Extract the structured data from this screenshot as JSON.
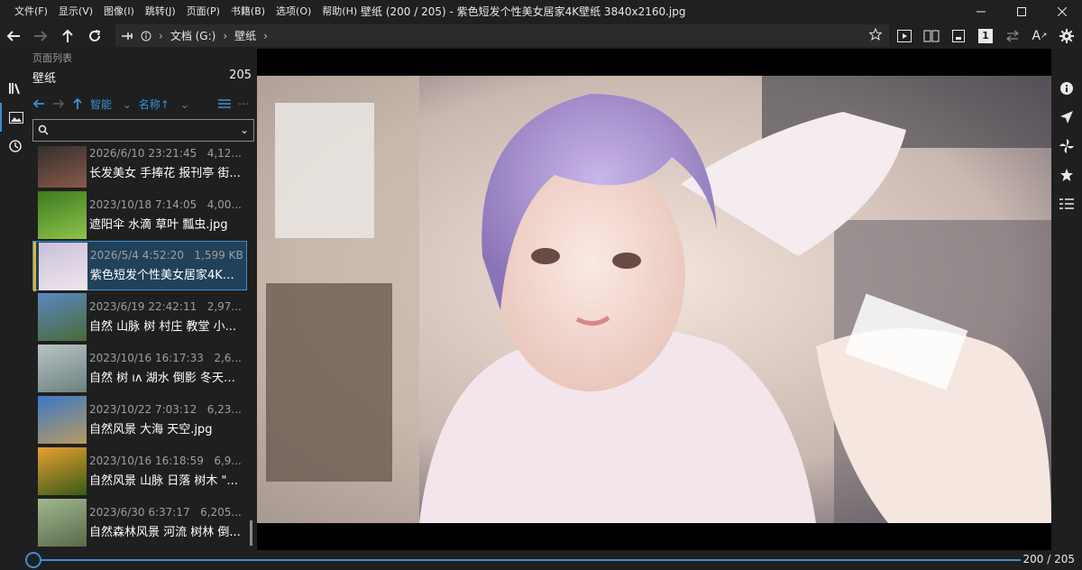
{
  "menu": [
    "文件(F)",
    "显示(V)",
    "图像(I)",
    "跳转(J)",
    "页面(P)",
    "书籍(B)",
    "选项(O)",
    "帮助(H)"
  ],
  "window": {
    "title": "壁纸 (200 / 205) - 紫色短发个性美女居家4K壁纸 3840x2160.jpg"
  },
  "address": {
    "drive": "文档 (G:)",
    "folder": "壁纸"
  },
  "toolbar": {
    "page_badge": "1",
    "text_size_label": "A"
  },
  "panel": {
    "title": "页面列表",
    "folder": "壁纸",
    "count": "205",
    "nav_mode": "智能",
    "sort_label": "名称↑",
    "search_placeholder": ""
  },
  "items": [
    {
      "date": "2026/6/10 23:21:45",
      "size": "4,12...",
      "name": "长发美女 手捧花 报刊亭 街...",
      "thumb": [
        "#2a2a2a",
        "#8a5a4a"
      ]
    },
    {
      "date": "2023/10/18 7:14:05",
      "size": "4,00...",
      "name": "遮阳伞 水滴 草叶 瓢虫.jpg",
      "thumb": [
        "#3d7a1f",
        "#8fc34a"
      ]
    },
    {
      "date": "2026/5/4 4:52:20",
      "size": "1,599 KB",
      "name": "紫色短发个性美女居家4K壁...",
      "thumb": [
        "#c9c0d8",
        "#f0e6ee"
      ]
    },
    {
      "date": "2023/6/19 22:42:11",
      "size": "2,97...",
      "name": "自然 山脉 树 村庄 教堂 小...",
      "thumb": [
        "#5a88c0",
        "#4a6a3a"
      ]
    },
    {
      "date": "2023/10/16 16:17:33",
      "size": "2,6...",
      "name": "自然 树 ıʌ 湖水 倒影 冬天风...",
      "thumb": [
        "#b8c4c4",
        "#6d8080"
      ]
    },
    {
      "date": "2023/10/22 7:03:12",
      "size": "6,23...",
      "name": "自然风景 大海 天空.jpg",
      "thumb": [
        "#3c78c8",
        "#b89a60"
      ]
    },
    {
      "date": "2023/10/16 16:18:59",
      "size": "6,9...",
      "name": "自然风景 山脉 日落 树木 \"...",
      "thumb": [
        "#e8a030",
        "#3a5a1a"
      ]
    },
    {
      "date": "2023/6/30 6:37:17",
      "size": "6,205...",
      "name": "自然森林风景 河流 树林 倒...",
      "thumb": [
        "#9fb890",
        "#5a6a4a"
      ]
    }
  ],
  "status": {
    "page": "200 / 205",
    "progress": 0.0
  },
  "colors": {
    "accent": "#3a8fd6",
    "selection": "#21415a",
    "marker": "#e6b21f"
  }
}
